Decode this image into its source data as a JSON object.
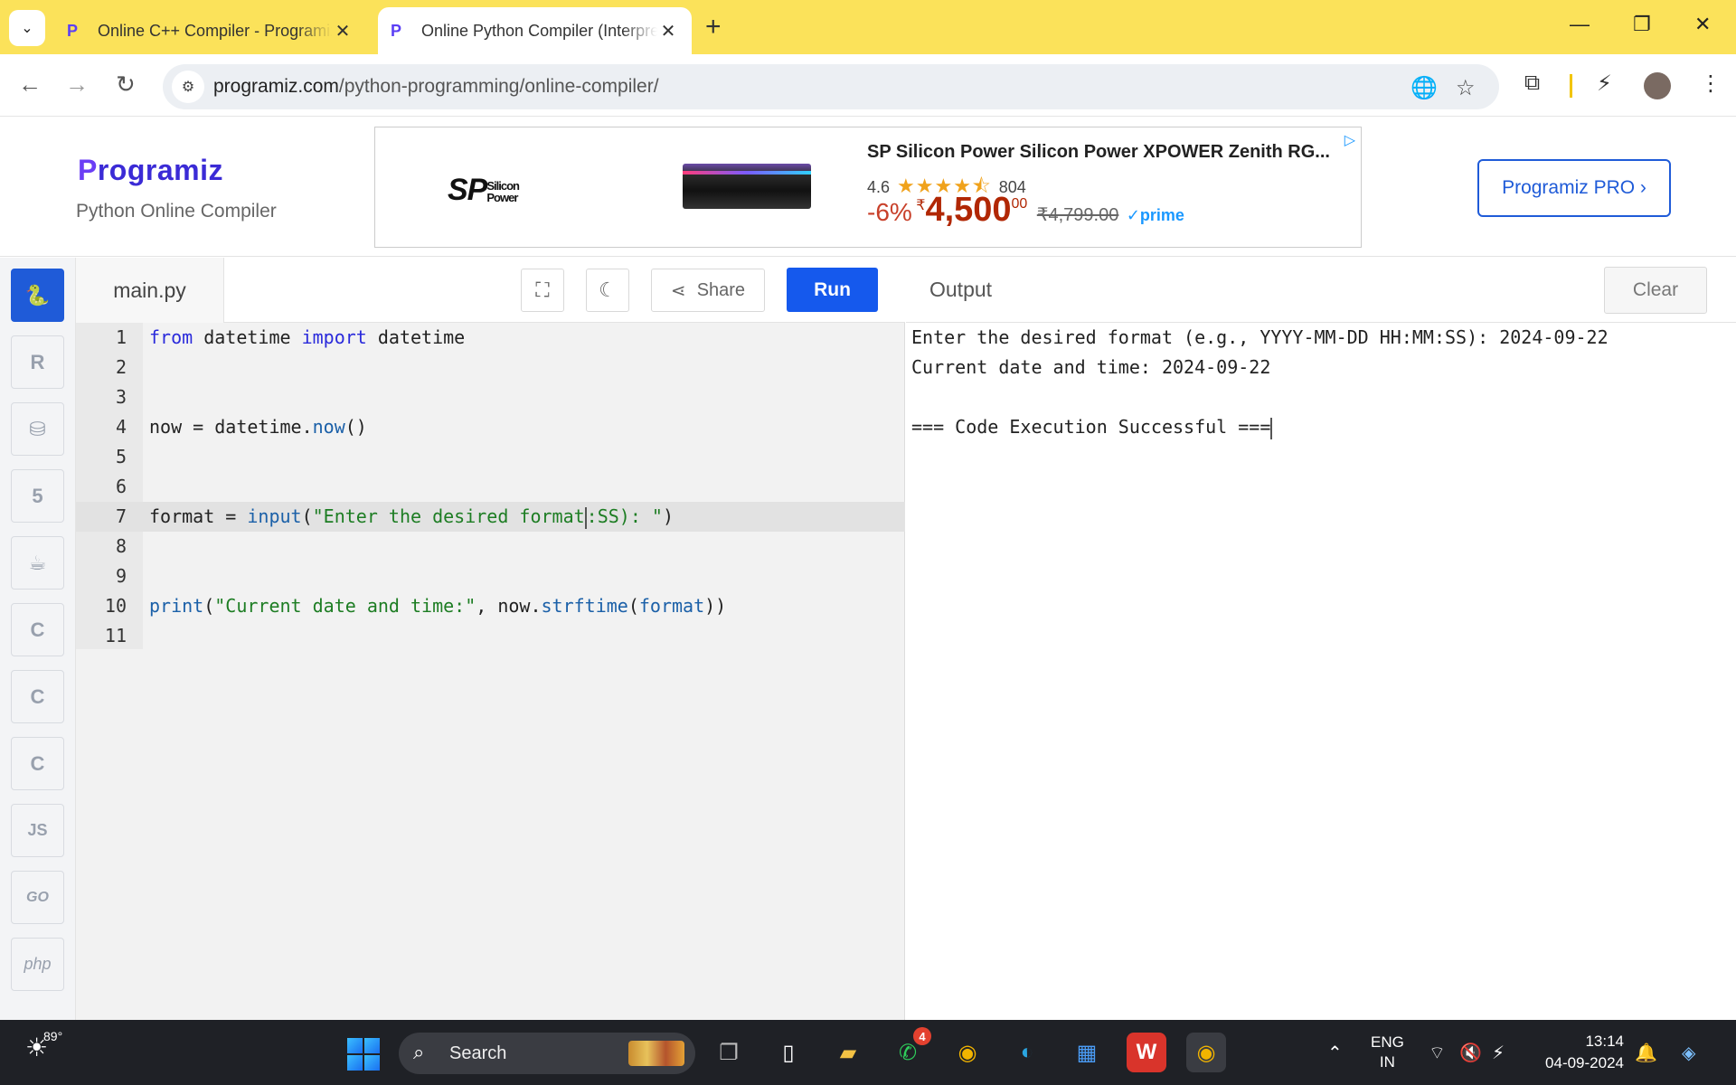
{
  "browser": {
    "tabs": [
      {
        "title": "Online C++ Compiler - Programiz",
        "active": false
      },
      {
        "title": "Online Python Compiler (Interpreter)",
        "active": true
      }
    ],
    "url_host": "programiz.com",
    "url_path": "/python-programming/online-compiler/"
  },
  "site": {
    "logo_text": "rogramiz",
    "logo_initial": "P",
    "subtitle": "Python Online Compiler",
    "pro_button": "Programiz PRO ›"
  },
  "ad": {
    "brand": "SP",
    "brand_sub1": "Silicon",
    "brand_sub2": "Power",
    "title": "SP Silicon Power Silicon Power XPOWER Zenith RG...",
    "rating": "4.6",
    "stars": "★★★★⯪",
    "reviews": "804",
    "discount": "-6%",
    "currency": "₹",
    "price": "4,500",
    "price_decimal": "00",
    "old_price": "₹4,799.00",
    "prime": "✓prime"
  },
  "languages": [
    {
      "id": "python",
      "glyph": "🐍",
      "active": true
    },
    {
      "id": "r",
      "glyph": "R"
    },
    {
      "id": "sql",
      "glyph": "⛁"
    },
    {
      "id": "html",
      "glyph": "5"
    },
    {
      "id": "java",
      "glyph": "☕"
    },
    {
      "id": "c",
      "glyph": "C"
    },
    {
      "id": "cpp",
      "glyph": "C"
    },
    {
      "id": "csharp",
      "glyph": "C"
    },
    {
      "id": "js",
      "glyph": "JS"
    },
    {
      "id": "go",
      "glyph": "GO"
    },
    {
      "id": "php",
      "glyph": "php"
    }
  ],
  "editor": {
    "filename": "main.py",
    "share_label": "Share",
    "run_label": "Run",
    "highlighted_line": 7,
    "lines": [
      {
        "n": "1"
      },
      {
        "n": "2"
      },
      {
        "n": "3"
      },
      {
        "n": "4"
      },
      {
        "n": "5"
      },
      {
        "n": "6"
      },
      {
        "n": "7"
      },
      {
        "n": "8"
      },
      {
        "n": "9"
      },
      {
        "n": "10"
      },
      {
        "n": "11"
      }
    ],
    "code": {
      "l1_kw1": "from",
      "l1_mod": " datetime ",
      "l1_kw2": "import",
      "l1_name": " datetime",
      "l4_a": "now = datetime.",
      "l4_fn": "now",
      "l4_b": "()",
      "l7_a": "format = ",
      "l7_fn": "input",
      "l7_b": "(",
      "l7_str1": "\"Enter the desired format",
      "l7_str2": ":SS): \"",
      "l7_c": ")",
      "l10_fn": "print",
      "l10_a": "(",
      "l10_str": "\"Current date and time:\"",
      "l10_b": ", now.",
      "l10_fn2": "strftime",
      "l10_c": "(",
      "l10_var": "format",
      "l10_d": "))"
    }
  },
  "output": {
    "title": "Output",
    "clear_label": "Clear",
    "lines": [
      "Enter the desired format (e.g., YYYY-MM-DD HH:MM:SS): 2024-09-22",
      "Current date and time: 2024-09-22",
      "",
      "=== Code Execution Successful ==="
    ]
  },
  "taskbar": {
    "temperature": "89°",
    "search_placeholder": "Search",
    "whatsapp_badge": "4",
    "lang_line1": "ENG",
    "lang_line2": "IN",
    "time": "13:14",
    "date": "04-09-2024"
  }
}
